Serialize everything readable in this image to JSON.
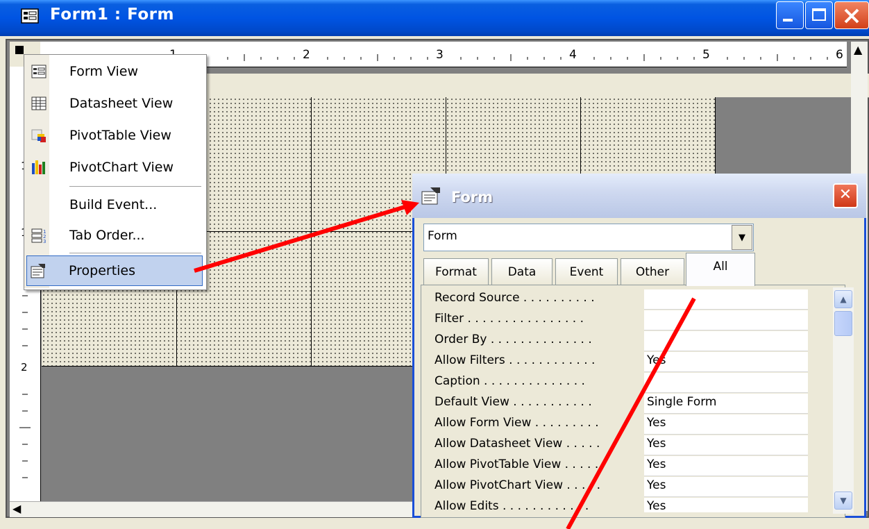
{
  "main_window": {
    "title": "Form1 : Form"
  },
  "ruler": {
    "labels": [
      "1",
      "2",
      "3",
      "4",
      "5",
      "6"
    ],
    "left_labels": [
      "1",
      "1",
      "2"
    ]
  },
  "context_menu": {
    "items": [
      {
        "label": "Form View",
        "icon": "form-view-icon"
      },
      {
        "label": "Datasheet View",
        "icon": "datasheet-view-icon"
      },
      {
        "label": "PivotTable View",
        "icon": "pivottable-view-icon"
      },
      {
        "label": "PivotChart View",
        "icon": "pivotchart-view-icon"
      },
      {
        "label": "Build Event...",
        "icon": ""
      },
      {
        "label": "Tab Order...",
        "icon": "tab-order-icon"
      },
      {
        "label": "Properties",
        "icon": "properties-icon"
      }
    ]
  },
  "property_sheet": {
    "title": "Form",
    "selected_object": "Form",
    "tabs": [
      "Format",
      "Data",
      "Event",
      "Other",
      "All"
    ],
    "active_tab": "All",
    "rows": [
      {
        "name": "Record Source . . . . . . . . . .",
        "value": ""
      },
      {
        "name": "Filter . . . . . . . . . . . . . . . .",
        "value": ""
      },
      {
        "name": "Order By . . . . . . . . . . . . . .",
        "value": ""
      },
      {
        "name": "Allow Filters . . . . . . . . . . . .",
        "value": "Yes"
      },
      {
        "name": "Caption . . . . . . . . . . . . . .",
        "value": ""
      },
      {
        "name": "Default View . . . . . . . . . . .",
        "value": "Single Form"
      },
      {
        "name": "Allow Form View . . . . . . . . .",
        "value": "Yes"
      },
      {
        "name": "Allow Datasheet View . . . . .",
        "value": "Yes"
      },
      {
        "name": "Allow PivotTable View . . . . .",
        "value": "Yes"
      },
      {
        "name": "Allow PivotChart View . . . . .",
        "value": "Yes"
      },
      {
        "name": "Allow Edits . . . . . . . . . . . .",
        "value": "Yes"
      }
    ]
  },
  "colors": {
    "titlebar": "#0054e3",
    "menu_highlight": "#c1d2ee",
    "annotation_arrow": "#ff0000"
  }
}
